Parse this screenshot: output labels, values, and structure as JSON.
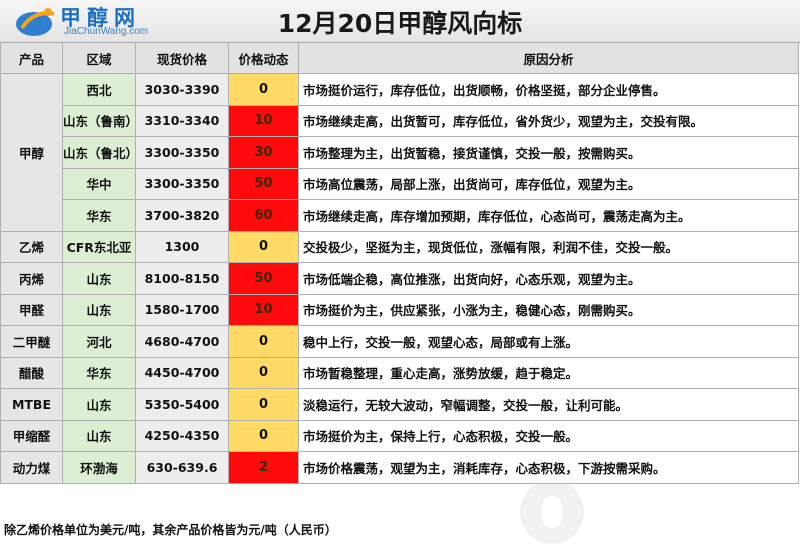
{
  "header": {
    "logo_cn": "甲醇网",
    "logo_en": "JiaChunWang.com",
    "title": "12月20日甲醇风向标"
  },
  "table": {
    "columns": [
      "产品",
      "区域",
      "现货价格",
      "价格动态",
      "原因分析"
    ],
    "groups": [
      {
        "product": "甲醇",
        "rows": [
          {
            "region": "西北",
            "price": "3030-3390",
            "change": "0",
            "reason": "市场挺价运行，库存低位，出货顺畅，价格坚挺，部分企业停售。"
          },
          {
            "region": "山东（鲁南）",
            "price": "3310-3340",
            "change": "10",
            "reason": "市场继续走高，出货暂可，库存低位，省外货少，观望为主，交投有限。"
          },
          {
            "region": "山东（鲁北）",
            "price": "3300-3350",
            "change": "30",
            "reason": "市场整理为主，出货暂稳，接货谨慎，交投一般，按需购买。"
          },
          {
            "region": "华中",
            "price": "3300-3350",
            "change": "50",
            "reason": "市场高位震荡，局部上涨，出货尚可，库存低位，观望为主。"
          },
          {
            "region": "华东",
            "price": "3700-3820",
            "change": "60",
            "reason": "市场继续走高，库存增加预期，库存低位，心态尚可，震荡走高为主。"
          }
        ]
      },
      {
        "product": "乙烯",
        "rows": [
          {
            "region": "CFR东北亚",
            "price": "1300",
            "change": "0",
            "reason": "交投极少，坚挺为主，现货低位，涨幅有限，利润不佳，交投一般。"
          }
        ]
      },
      {
        "product": "丙烯",
        "rows": [
          {
            "region": "山东",
            "price": "8100-8150",
            "change": "50",
            "reason": "市场低端企稳，高位推涨，出货向好，心态乐观，观望为主。"
          }
        ]
      },
      {
        "product": "甲醛",
        "rows": [
          {
            "region": "山东",
            "price": "1580-1700",
            "change": "10",
            "reason": "市场挺价为主，供应紧张，小涨为主，稳健心态，刚需购买。"
          }
        ]
      },
      {
        "product": "二甲醚",
        "rows": [
          {
            "region": "河北",
            "price": "4680-4700",
            "change": "0",
            "reason": "稳中上行，交投一般，观望心态，局部或有上涨。"
          }
        ]
      },
      {
        "product": "醋酸",
        "rows": [
          {
            "region": "华东",
            "price": "4450-4700",
            "change": "0",
            "reason": "市场暂稳整理，重心走高，涨势放缓，趋于稳定。"
          }
        ]
      },
      {
        "product": "MTBE",
        "rows": [
          {
            "region": "山东",
            "price": "5350-5400",
            "change": "0",
            "reason": "淡稳运行，无较大波动，窄幅调整，交投一般，让利可能。"
          }
        ]
      },
      {
        "product": "甲缩醛",
        "rows": [
          {
            "region": "山东",
            "price": "4250-4350",
            "change": "0",
            "reason": "市场挺价为主，保持上行，心态积极，交投一般。"
          }
        ]
      },
      {
        "product": "动力煤",
        "rows": [
          {
            "region": "环渤海",
            "price": "630-639.6",
            "change": "2",
            "reason": "市场价格震荡，观望为主，消耗库存，心态积极，下游按需采购。"
          }
        ]
      }
    ]
  },
  "footnote": "除乙烯价格单位为美元/吨，其余产品价格皆为元/吨（人民币）",
  "colors": {
    "change_zero": "#ffdb66",
    "change_up": "#ff0a0a",
    "region_bg": "#dcefd3",
    "header_bg": "#e2e2e2"
  }
}
